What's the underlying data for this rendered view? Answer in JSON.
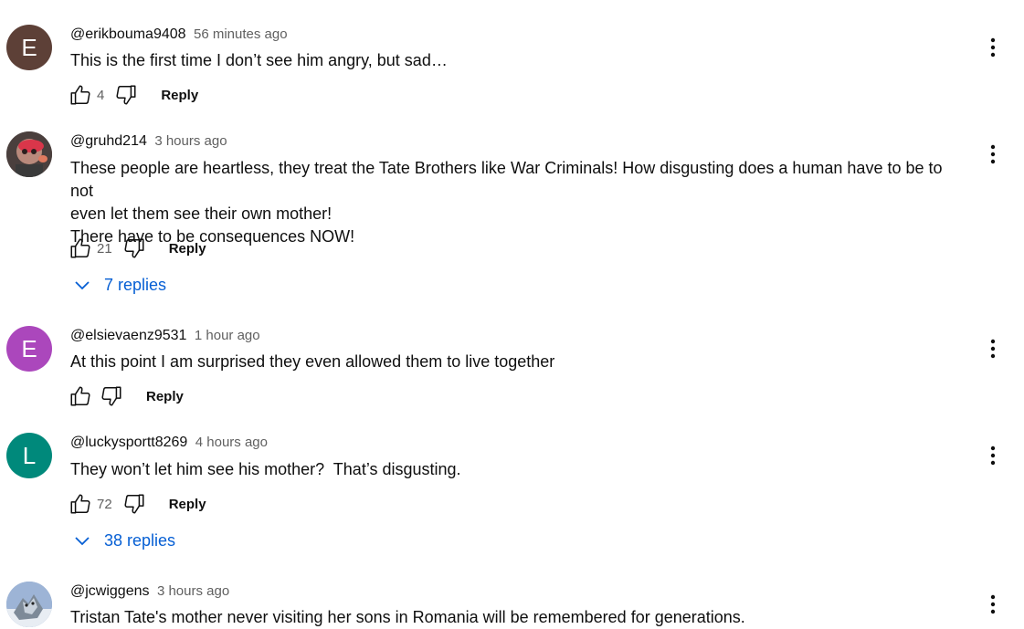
{
  "comments": [
    {
      "author": "@erikbouma9408",
      "time": "56 minutes ago",
      "lines": [
        "This is the first time I don’t see him angry, but sad…"
      ],
      "likes": "4",
      "reply_label": "Reply",
      "avatar": {
        "type": "letter",
        "letter": "E",
        "color": "#5d4037"
      }
    },
    {
      "author": "@gruhd214",
      "time": "3 hours ago",
      "lines": [
        "These people are heartless, they treat the Tate Brothers like War Criminals! How disgusting does a human have to be to not",
        "even let them see their own mother!",
        "There have to be consequences NOW!"
      ],
      "likes": "21",
      "reply_label": "Reply",
      "replies_label": "7 replies",
      "avatar": {
        "type": "image",
        "color": "#6b5a55"
      }
    },
    {
      "author": "@elsievaenz9531",
      "time": "1 hour ago",
      "lines": [
        "At this point I am surprised they even allowed them to live together"
      ],
      "likes": "",
      "reply_label": "Reply",
      "avatar": {
        "type": "letter",
        "letter": "E",
        "color": "#ab47bc"
      }
    },
    {
      "author": "@luckysportt8269",
      "time": "4 hours ago",
      "lines": [
        "They won’t let him see his mother?  That’s disgusting."
      ],
      "likes": "72",
      "reply_label": "Reply",
      "replies_label": "38 replies",
      "avatar": {
        "type": "letter",
        "letter": "L",
        "color": "#00897b"
      }
    },
    {
      "author": "@jcwiggens",
      "time": "3 hours ago",
      "lines": [
        "Tristan Tate's mother never visiting her sons in Romania will be remembered for generations."
      ],
      "avatar": {
        "type": "image",
        "color": "#8aa4c8"
      }
    }
  ],
  "icons": {
    "like": "thumbs-up-icon",
    "dislike": "thumbs-down-icon",
    "more": "more-vertical-icon",
    "expand": "chevron-down-icon"
  },
  "colors": {
    "link_blue": "#065fd4",
    "secondary_text": "#606060"
  }
}
